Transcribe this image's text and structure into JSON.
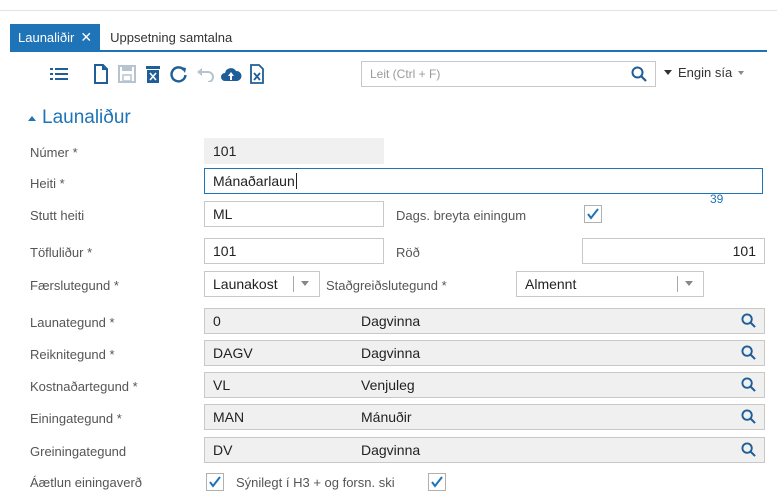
{
  "tabs": {
    "active": "Launaliðir",
    "active_close": "✕",
    "second": "Uppsetning samtalna"
  },
  "toolbar": {
    "icons": [
      "list-icon",
      "new-doc-icon",
      "save-icon",
      "delete-icon",
      "refresh-icon",
      "undo-icon",
      "cloud-upload-icon",
      "excel-icon"
    ],
    "search_placeholder": "Leit (Ctrl + F)",
    "filter_label": "Engin sía"
  },
  "section_title": "Launaliður",
  "form": {
    "numer": {
      "label": "Númer *",
      "value": "101"
    },
    "heiti": {
      "label": "Heiti *",
      "value": "Mánaðarlaun",
      "counter": "39"
    },
    "stutt": {
      "label": "Stutt heiti",
      "value": "ML"
    },
    "dags": {
      "label": "Dags. breyta einingum",
      "checked": true
    },
    "tofluliður": {
      "label": "Töfluliður *",
      "value": "101"
    },
    "rod": {
      "label": "Röð",
      "value": "101"
    },
    "faerslutegund": {
      "label": "Færslutegund *",
      "value": "Launakost"
    },
    "stadgreidslutegund": {
      "label": "Staðgreiðslutegund *",
      "value": "Almennt"
    },
    "launategund": {
      "label": "Launategund *",
      "code": "0",
      "desc": "Dagvinna"
    },
    "reiknitegund": {
      "label": "Reiknitegund *",
      "code": "DAGV",
      "desc": "Dagvinna"
    },
    "kostnadartegund": {
      "label": "Kostnaðartegund *",
      "code": "VL",
      "desc": "Venjuleg"
    },
    "einingategund": {
      "label": "Einingategund *",
      "code": "MAN",
      "desc": "Mánuðir"
    },
    "greiningategund": {
      "label": "Greiningategund",
      "code": "DV",
      "desc": "Dagvinna"
    },
    "partial": {
      "label": "Áætlun einingaverð",
      "checked": true,
      "mid_label": "Sýnilegt í H3 + og forsn. ski",
      "mid_checked": true
    }
  },
  "colors": {
    "accent": "#1f73b7",
    "field_border": "#c8c8c8",
    "readonly_bg": "#f0f0f0"
  }
}
